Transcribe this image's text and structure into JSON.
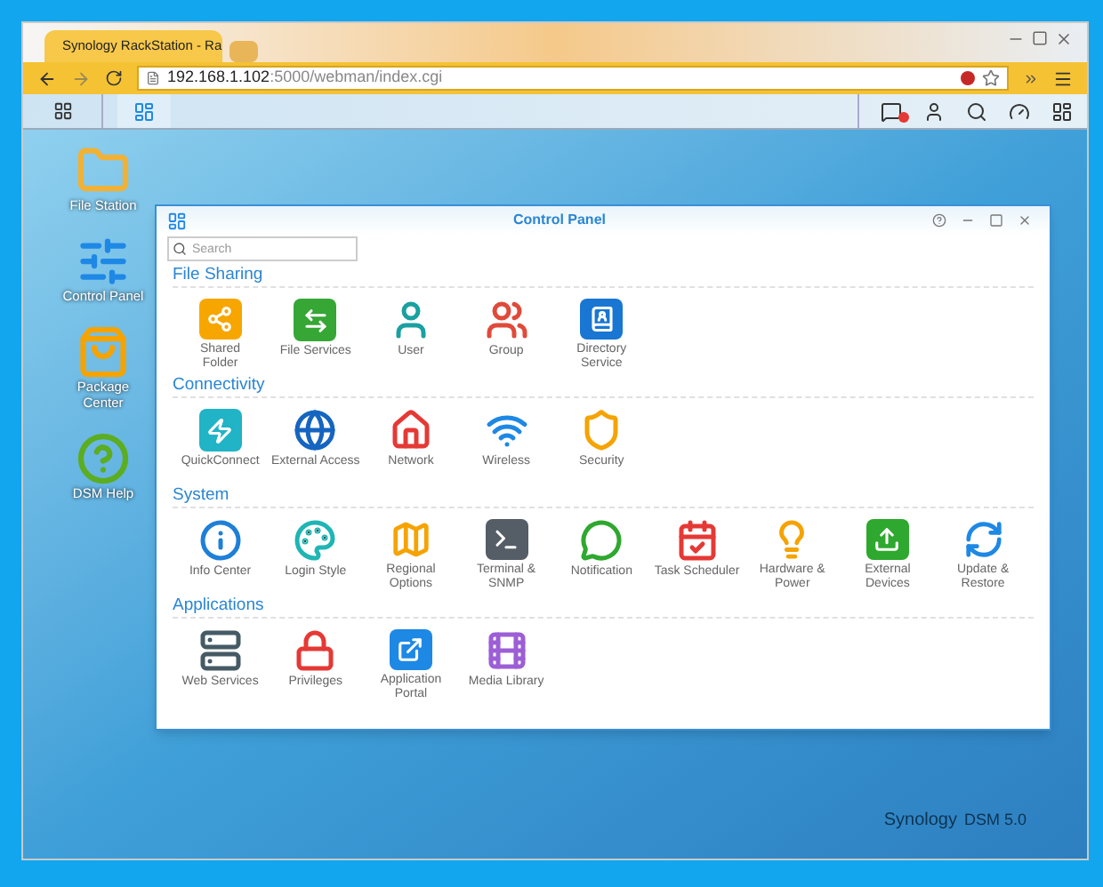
{
  "browser": {
    "tab_title": "Synology RackStation - Ra",
    "address": {
      "host": "192.168.1.102",
      "path": ":5000/webman/index.cgi"
    }
  },
  "desktop_icons": [
    {
      "label": "File Station"
    },
    {
      "label": "Control Panel"
    },
    {
      "label": "Package Center"
    },
    {
      "label": "DSM Help"
    }
  ],
  "control_panel": {
    "title": "Control Panel",
    "search": {
      "placeholder": "Search"
    },
    "sections": [
      {
        "title": "File Sharing",
        "items": [
          {
            "lines": [
              "Shared",
              "Folder"
            ]
          },
          {
            "lines": [
              "File Services"
            ]
          },
          {
            "lines": [
              "User"
            ]
          },
          {
            "lines": [
              "Group"
            ]
          },
          {
            "lines": [
              "Directory",
              "Service"
            ]
          }
        ]
      },
      {
        "title": "Connectivity",
        "items": [
          {
            "lines": [
              "QuickConnect"
            ]
          },
          {
            "lines": [
              "External Access"
            ]
          },
          {
            "lines": [
              "Network"
            ]
          },
          {
            "lines": [
              "Wireless"
            ]
          },
          {
            "lines": [
              "Security"
            ]
          }
        ]
      },
      {
        "title": "System",
        "items": [
          {
            "lines": [
              "Info Center"
            ]
          },
          {
            "lines": [
              "Login Style"
            ]
          },
          {
            "lines": [
              "Regional",
              "Options"
            ]
          },
          {
            "lines": [
              "Terminal &",
              "SNMP"
            ]
          },
          {
            "lines": [
              "Notification"
            ]
          },
          {
            "lines": [
              "Task Scheduler"
            ]
          },
          {
            "lines": [
              "Hardware &",
              "Power"
            ]
          },
          {
            "lines": [
              "External",
              "Devices"
            ]
          },
          {
            "lines": [
              "Update &",
              "Restore"
            ]
          }
        ]
      },
      {
        "title": "Applications",
        "items": [
          {
            "lines": [
              "Web Services"
            ]
          },
          {
            "lines": [
              "Privileges"
            ]
          },
          {
            "lines": [
              "Application",
              "Portal"
            ]
          },
          {
            "lines": [
              "Media Library"
            ]
          }
        ]
      }
    ]
  },
  "wallpaper_brand": {
    "name": "Synology",
    "version": "DSM 5.0"
  }
}
